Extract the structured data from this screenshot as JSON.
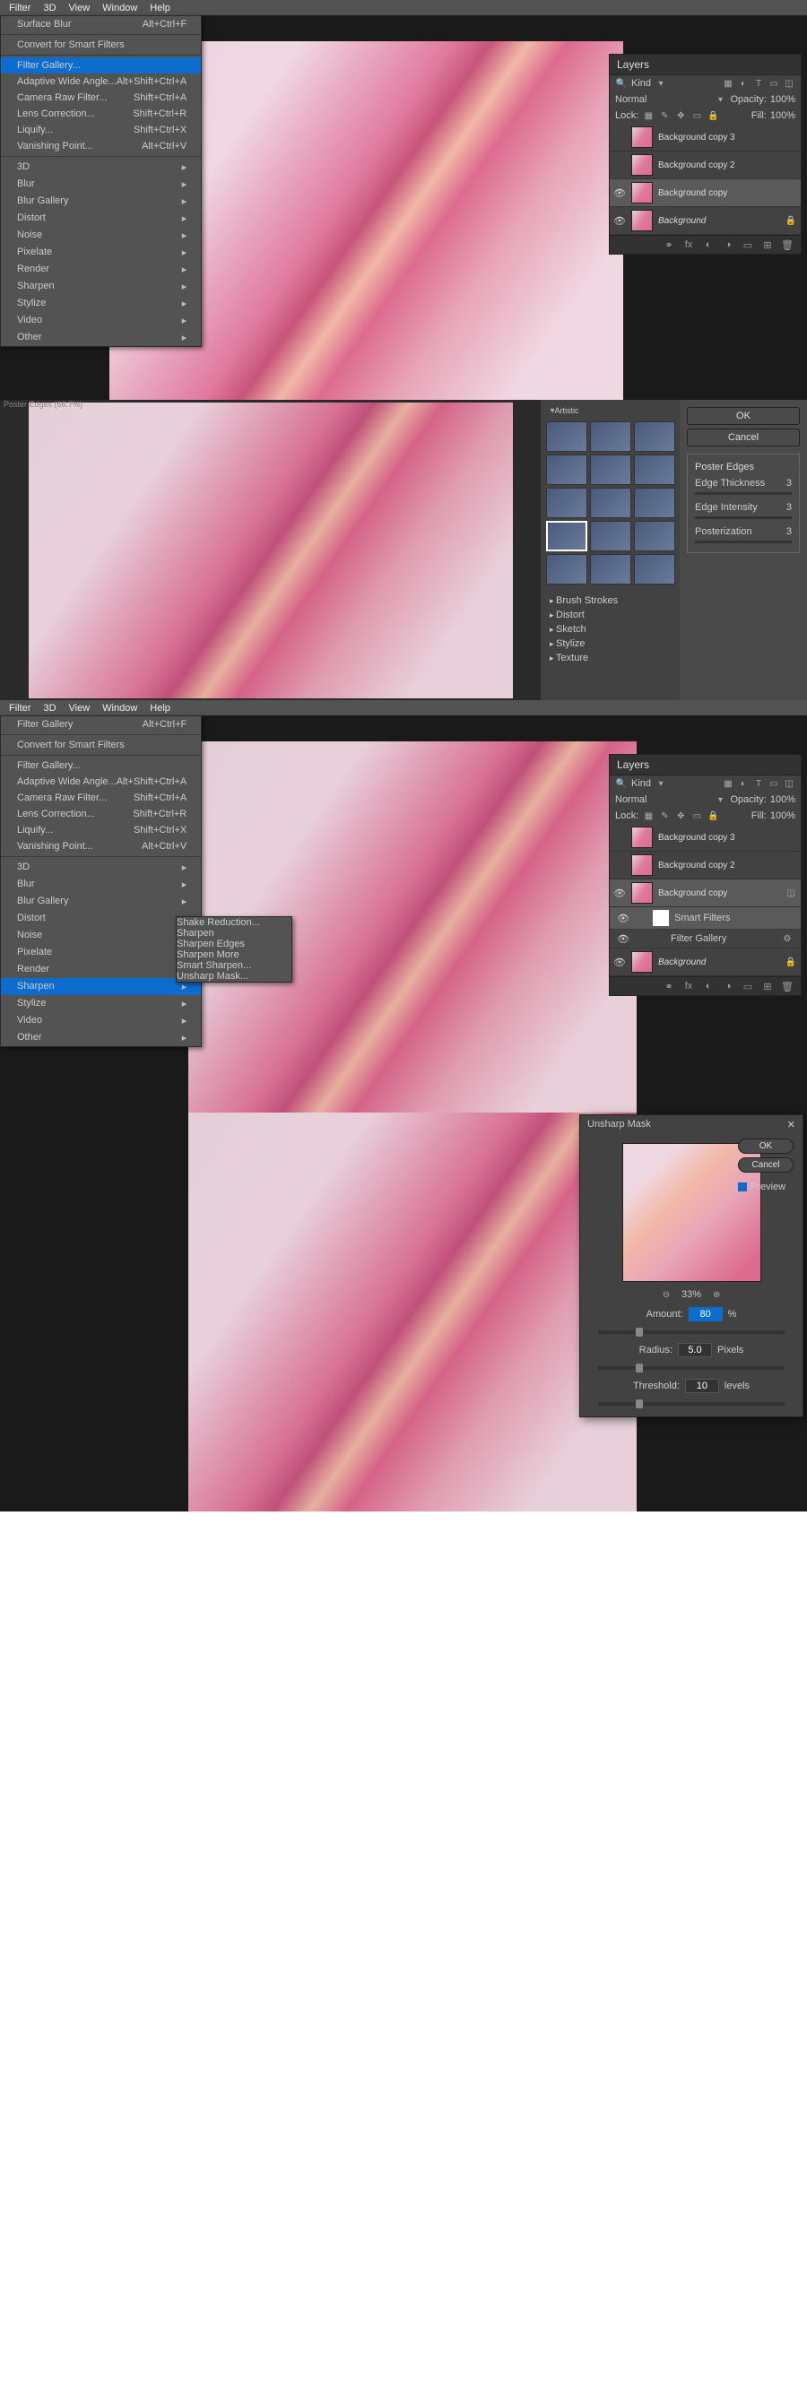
{
  "menubar": {
    "items": [
      "Filter",
      "3D",
      "View",
      "Window",
      "Help"
    ]
  },
  "panel1": {
    "top_item": {
      "label": "Surface Blur",
      "shortcut": "Alt+Ctrl+F"
    },
    "convert": "Convert for Smart Filters",
    "highlighted": "Filter Gallery...",
    "group2": [
      {
        "label": "Adaptive Wide Angle...",
        "shortcut": "Alt+Shift+Ctrl+A"
      },
      {
        "label": "Camera Raw Filter...",
        "shortcut": "Shift+Ctrl+A"
      },
      {
        "label": "Lens Correction...",
        "shortcut": "Shift+Ctrl+R"
      },
      {
        "label": "Liquify...",
        "shortcut": "Shift+Ctrl+X"
      },
      {
        "label": "Vanishing Point...",
        "shortcut": "Alt+Ctrl+V"
      }
    ],
    "group3": [
      "3D",
      "Blur",
      "Blur Gallery",
      "Distort",
      "Noise",
      "Pixelate",
      "Render",
      "Sharpen",
      "Stylize",
      "Video",
      "Other"
    ],
    "layers": {
      "title": "Layers",
      "kind": "Kind",
      "blend": "Normal",
      "opacity_label": "Opacity:",
      "opacity": "100%",
      "lock": "Lock:",
      "fill_label": "Fill:",
      "fill": "100%",
      "items": [
        {
          "name": "Background copy 3",
          "vis": false,
          "sel": false
        },
        {
          "name": "Background copy 2",
          "vis": false,
          "sel": false
        },
        {
          "name": "Background copy",
          "vis": true,
          "sel": true
        },
        {
          "name": "Background",
          "vis": true,
          "sel": false,
          "italic": true
        }
      ]
    }
  },
  "panel2": {
    "title": "Poster Edges (66.7%)",
    "ok": "OK",
    "cancel": "Cancel",
    "box_title": "Poster Edges",
    "sliders": [
      {
        "label": "Edge Thickness",
        "val": "3"
      },
      {
        "label": "Edge Intensity",
        "val": "3"
      },
      {
        "label": "Posterization",
        "val": "3"
      }
    ],
    "folders": [
      "Brush Strokes",
      "Distort",
      "Sketch",
      "Stylize",
      "Texture"
    ]
  },
  "panel3": {
    "top_item": {
      "label": "Filter Gallery",
      "shortcut": "Alt+Ctrl+F"
    },
    "convert": "Convert for Smart Filters",
    "group1": [
      "Filter Gallery..."
    ],
    "group2": [
      {
        "label": "Adaptive Wide Angle...",
        "shortcut": "Alt+Shift+Ctrl+A"
      },
      {
        "label": "Camera Raw Filter...",
        "shortcut": "Shift+Ctrl+A"
      },
      {
        "label": "Lens Correction...",
        "shortcut": "Shift+Ctrl+R"
      },
      {
        "label": "Liquify...",
        "shortcut": "Shift+Ctrl+X"
      },
      {
        "label": "Vanishing Point...",
        "shortcut": "Alt+Ctrl+V"
      }
    ],
    "group3": [
      "3D",
      "Blur",
      "Blur Gallery",
      "Distort",
      "Noise",
      "Pixelate",
      "Render"
    ],
    "highlighted": "Sharpen",
    "group3b": [
      "Stylize",
      "Video",
      "Other"
    ],
    "submenu": [
      "Shake Reduction...",
      "Sharpen",
      "Sharpen Edges",
      "Sharpen More",
      "Smart Sharpen..."
    ],
    "submenu_hl": "Unsharp Mask...",
    "layers": {
      "title": "Layers",
      "items": [
        {
          "name": "Background copy 3"
        },
        {
          "name": "Background copy 2"
        },
        {
          "name": "Background copy",
          "sel": true,
          "vis": true
        }
      ],
      "smartfilters": "Smart Filters",
      "filtergallery": "Filter Gallery",
      "bg": "Background"
    }
  },
  "panel4": {
    "dialog": {
      "title": "Unsharp Mask",
      "ok": "OK",
      "cancel": "Cancel",
      "preview": "Preview",
      "zoom": "33%",
      "amount_label": "Amount:",
      "amount": "80",
      "amount_unit": "%",
      "radius_label": "Radius:",
      "radius": "5.0",
      "radius_unit": "Pixels",
      "threshold_label": "Threshold:",
      "threshold": "10",
      "threshold_unit": "levels"
    }
  }
}
